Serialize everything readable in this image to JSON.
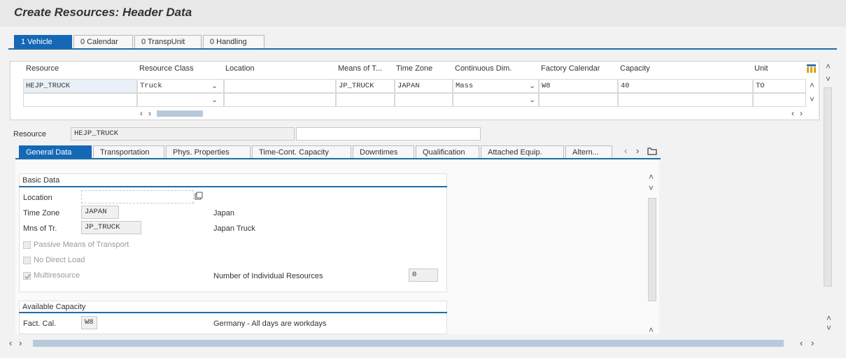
{
  "page_title": "Create Resources: Header Data",
  "top_tabs": [
    {
      "label": "1 Vehicle",
      "active": true
    },
    {
      "label": "0 Calendar",
      "active": false
    },
    {
      "label": "0 TranspUnit",
      "active": false
    },
    {
      "label": "0 Handling",
      "active": false
    }
  ],
  "grid": {
    "columns": [
      "Resource",
      "Resource Class",
      "Location",
      "Means of T...",
      "Time Zone",
      "Continuous Dim.",
      "Factory Calendar",
      "Capacity",
      "Unit"
    ],
    "row1": {
      "resource": "HEJP_TRUCK",
      "resource_class": "Truck",
      "location": "",
      "means": "JP_TRUCK",
      "time_zone": "JAPAN",
      "continuous_dim": "Mass",
      "factory_calendar": "W8",
      "capacity": "40",
      "unit": "TO"
    }
  },
  "resource_header": {
    "label": "Resource",
    "value": "HEJP_TRUCK",
    "description": ""
  },
  "sub_tabs": [
    {
      "label": "General Data",
      "active": true
    },
    {
      "label": "Transportation"
    },
    {
      "label": "Phys. Properties"
    },
    {
      "label": "Time-Cont. Capacity"
    },
    {
      "label": "Downtimes"
    },
    {
      "label": "Qualification"
    },
    {
      "label": "Attached Equip."
    },
    {
      "label": "Altern..."
    }
  ],
  "basic_data": {
    "title": "Basic Data",
    "location_label": "Location",
    "location_value": "",
    "time_zone_label": "Time Zone",
    "time_zone_value": "JAPAN",
    "time_zone_text": "Japan",
    "mns_label": "Mns of Tr.",
    "mns_value": "JP_TRUCK",
    "mns_text": "Japan Truck",
    "passive_label": "Passive Means of Transport",
    "no_direct_label": "No Direct Load",
    "multiresource_label": "Multiresource",
    "num_individual_label": "Number of Individual Resources",
    "num_individual_value": "0"
  },
  "available_capacity": {
    "title": "Available Capacity",
    "fact_cal_label": "Fact. Cal.",
    "fact_cal_value": "W8",
    "fact_cal_text": "Germany - All days are workdays"
  },
  "icons": {
    "left": "‹",
    "right": "›",
    "up": "˄",
    "down": "˅",
    "caret": "⌄"
  }
}
